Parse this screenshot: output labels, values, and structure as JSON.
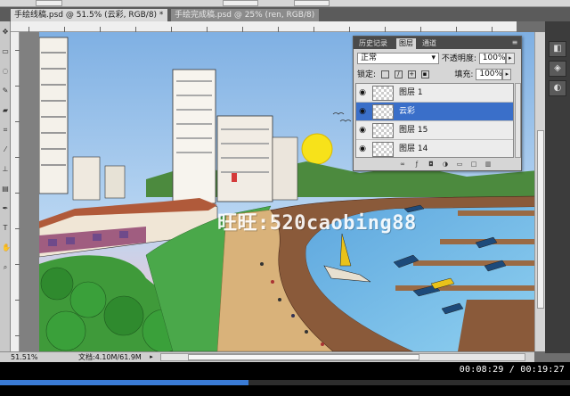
{
  "tabs": [
    {
      "label": "手绘线稿.psd @ 51.5% (云彩, RGB/8) *",
      "close": "×"
    },
    {
      "label": "手绘完成稿.psd @ 25% (ren, RGB/8)",
      "close": "×"
    }
  ],
  "canvas": {
    "watermark": "旺旺:520caobing88"
  },
  "layers_panel": {
    "tabs": [
      "历史记录",
      "图层",
      "通道"
    ],
    "menu_icon": "panel-menu-icon",
    "blend_mode": "正常",
    "opacity_label": "不透明度:",
    "opacity_value": "100%",
    "lock_label": "锁定:",
    "fill_label": "填充:",
    "fill_value": "100%",
    "layers": [
      {
        "name": "图层 1",
        "selected": false
      },
      {
        "name": "云彩",
        "selected": true
      },
      {
        "name": "图层 15",
        "selected": false
      },
      {
        "name": "图层 14",
        "selected": false
      }
    ]
  },
  "status_bar": {
    "zoom": "51.51%",
    "doc_info": "文档:4.10M/61.9M"
  },
  "player": {
    "time": "00:08:29 / 00:19:27",
    "progress": 0.436
  },
  "colors": {
    "selection": "#3a6fc9",
    "sky": "#8fb9e6",
    "water": "#6fb8e6",
    "greenery": "#3f9a3a"
  }
}
